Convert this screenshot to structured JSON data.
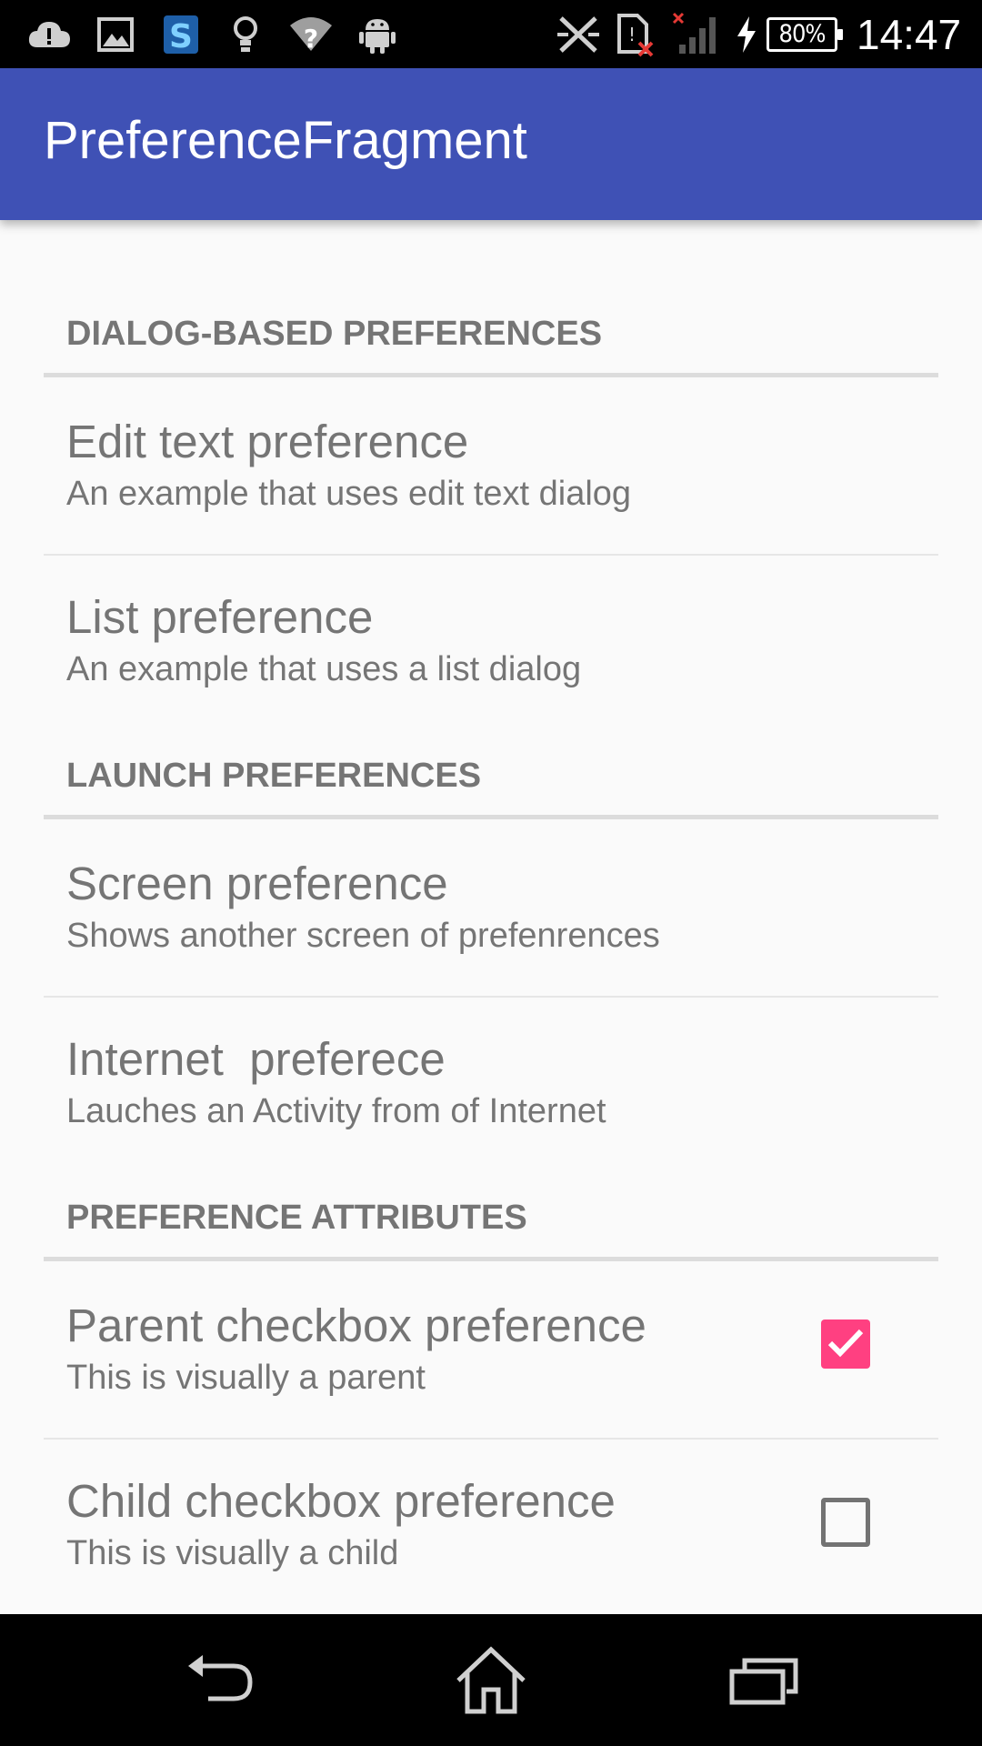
{
  "status_bar": {
    "icons": [
      "cloud-alert-icon",
      "image-icon",
      "s-app-icon",
      "lightbulb-icon",
      "wifi-question-icon",
      "android-icon",
      "no-sync-icon",
      "sim-error-icon",
      "signal-none-icon",
      "charging-icon"
    ],
    "battery": "80%",
    "time": "14:47"
  },
  "app_bar": {
    "title": "PreferenceFragment"
  },
  "preferences": {
    "partial_summary": "off",
    "categories": [
      {
        "title": "DIALOG-BASED PREFERENCES",
        "items": [
          {
            "title": "Edit text preference",
            "summary": "An example that uses edit text dialog"
          },
          {
            "title": "List preference",
            "summary": "An example that uses a list dialog"
          }
        ]
      },
      {
        "title": "LAUNCH PREFERENCES",
        "items": [
          {
            "title": "Screen preference",
            "summary": "Shows another screen of prefenrences"
          },
          {
            "title": "Internet  preferece",
            "summary": "Lauches an Activity from of Internet"
          }
        ]
      },
      {
        "title": "PREFERENCE ATTRIBUTES",
        "items": [
          {
            "title": "Parent checkbox preference",
            "summary": "This is visually a parent",
            "checked": true
          },
          {
            "title": "Child checkbox preference",
            "summary": "This is visually a child",
            "checked": false
          }
        ]
      }
    ]
  },
  "colors": {
    "primary": "#3f51b5",
    "accent": "#ff4081",
    "text_secondary": "#757575"
  },
  "nav_bar": {
    "buttons": [
      "back-icon",
      "home-icon",
      "recents-icon"
    ]
  }
}
